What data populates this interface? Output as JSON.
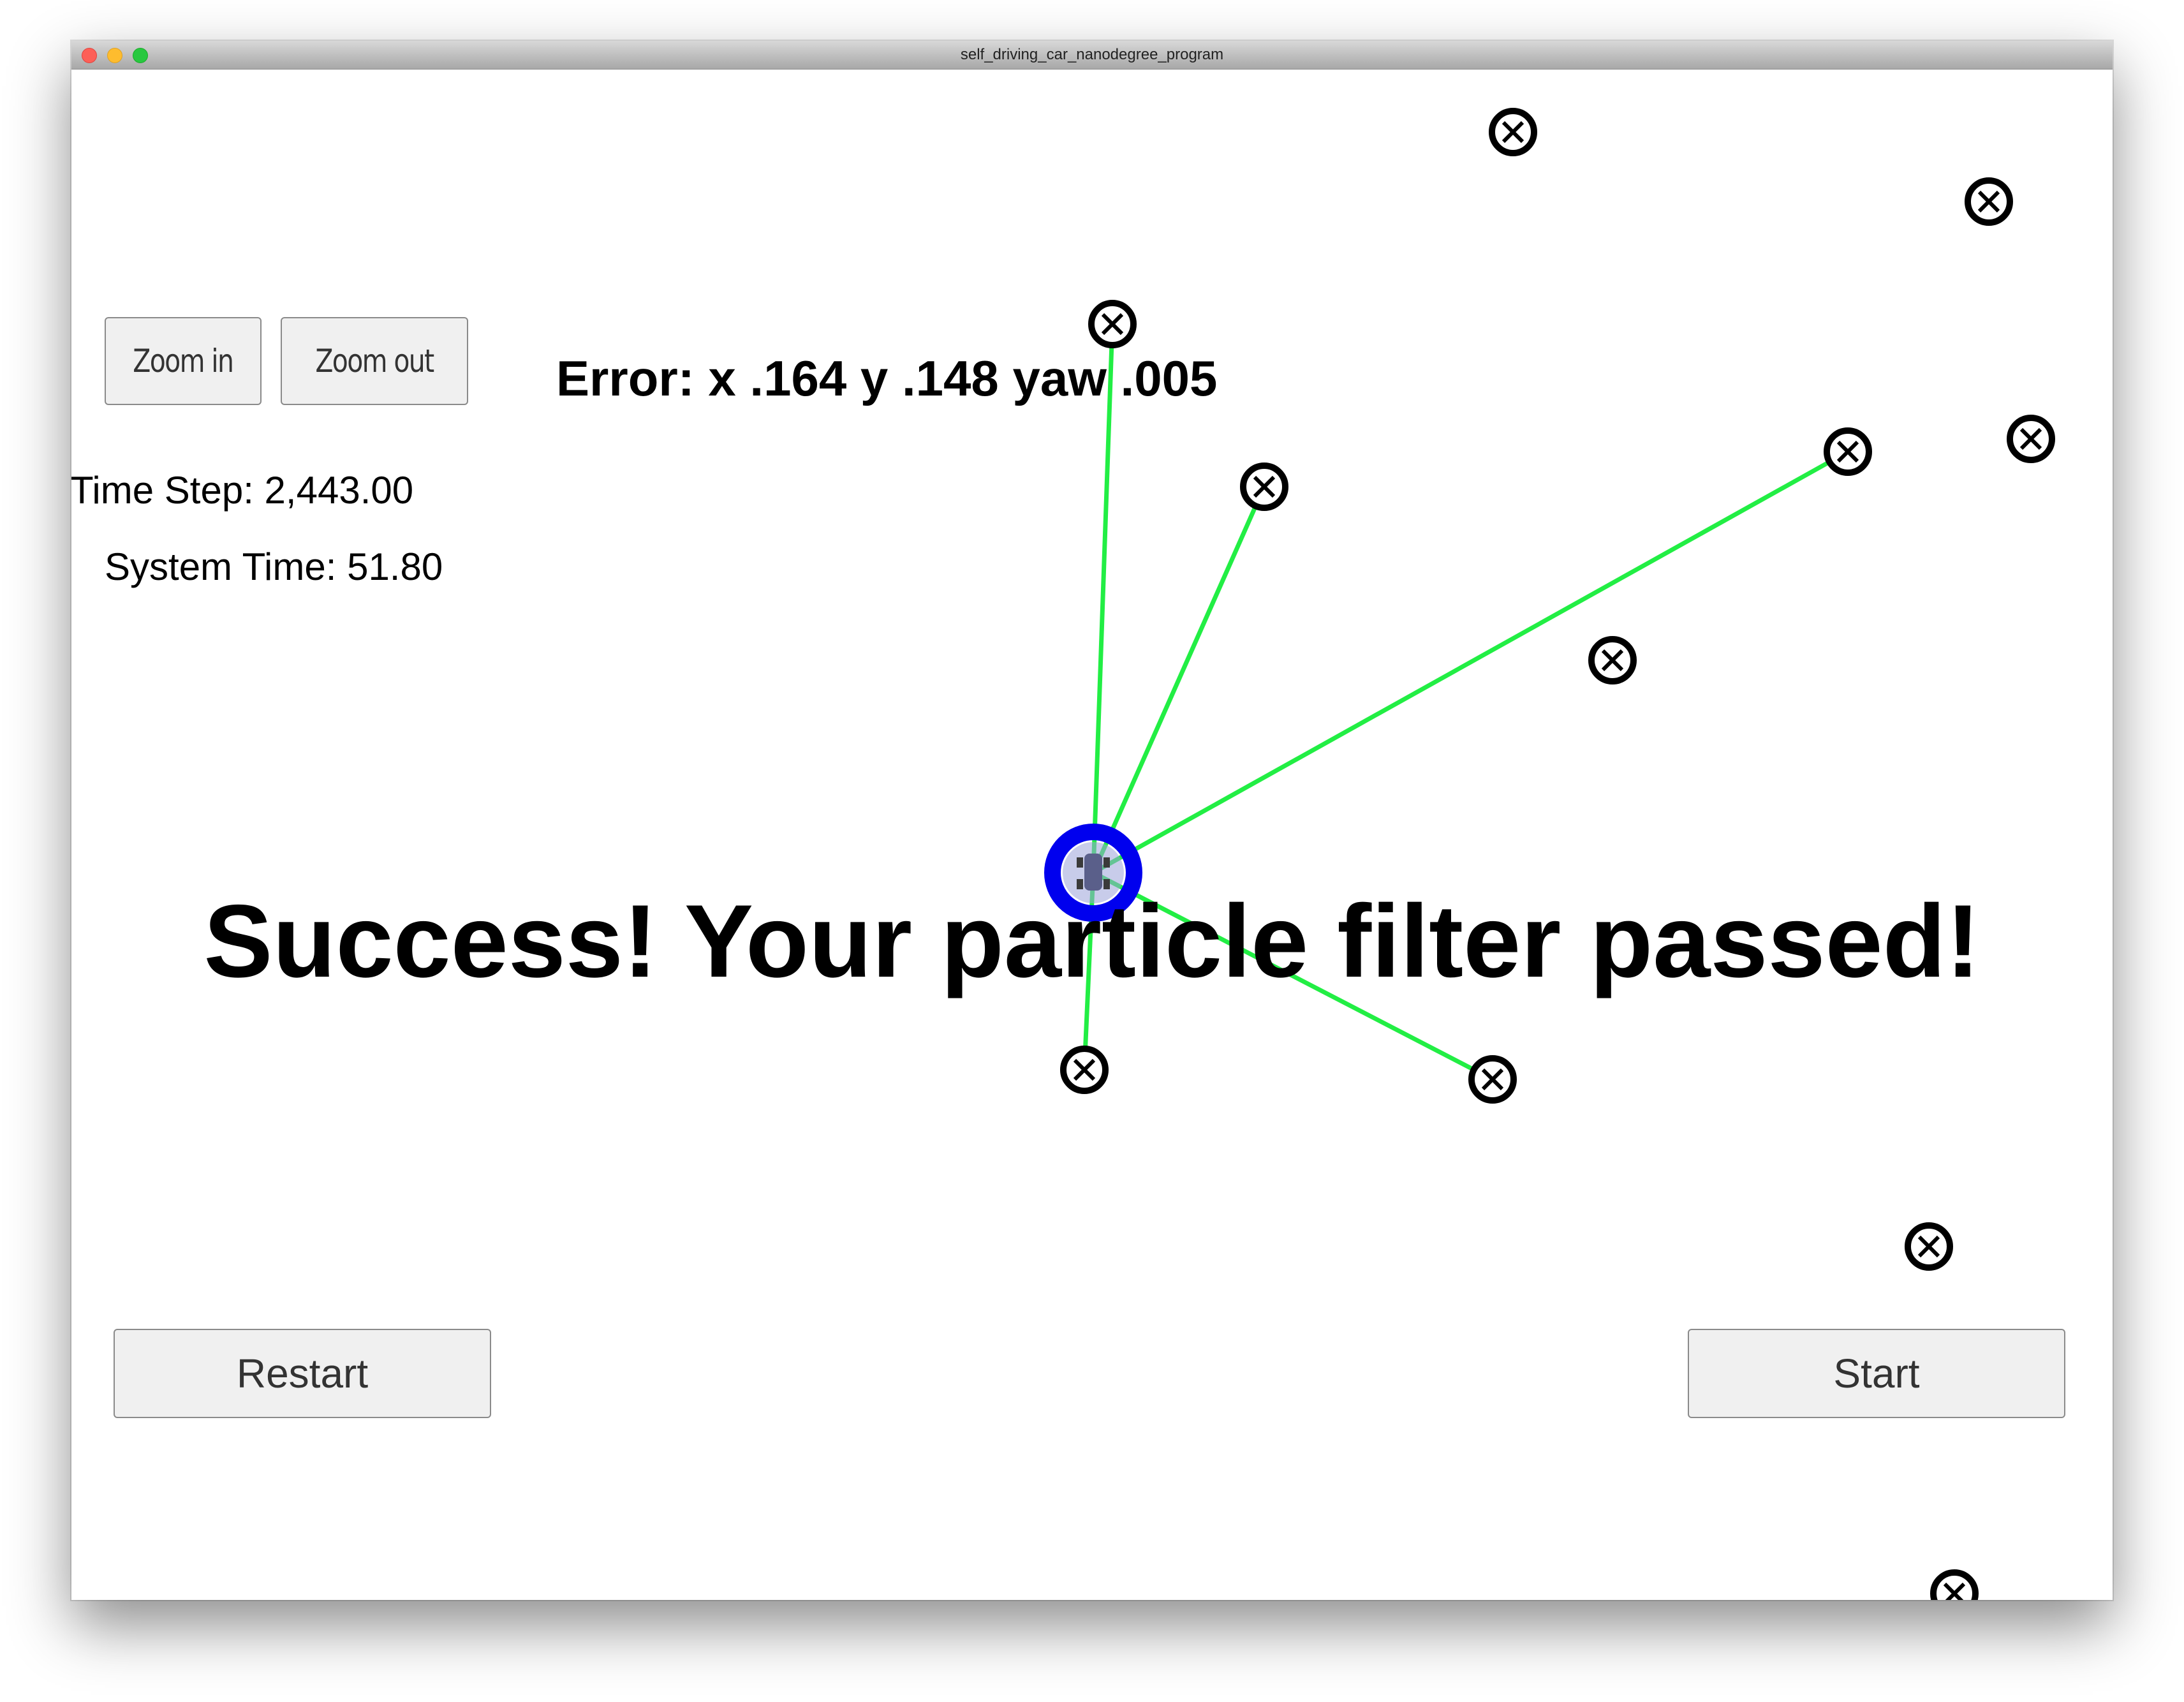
{
  "window": {
    "title": "self_driving_car_nanodegree_program"
  },
  "controls": {
    "zoom_in_label": "Zoom in",
    "zoom_out_label": "Zoom out",
    "restart_label": "Restart",
    "start_label": "Start"
  },
  "hud": {
    "time_step": "Time Step: 2,443.00",
    "system_time": "System Time: 51.80",
    "error": "Error: x .164 y .148 yaw .005",
    "message": "Success! Your particle filter passed!"
  },
  "colors": {
    "observation_line": "#22ee44",
    "vehicle_ring": "#0000ee",
    "landmark": "#000000"
  },
  "icons": {
    "landmark": "landmark-x-circle-icon",
    "vehicle": "vehicle-marker-icon"
  }
}
